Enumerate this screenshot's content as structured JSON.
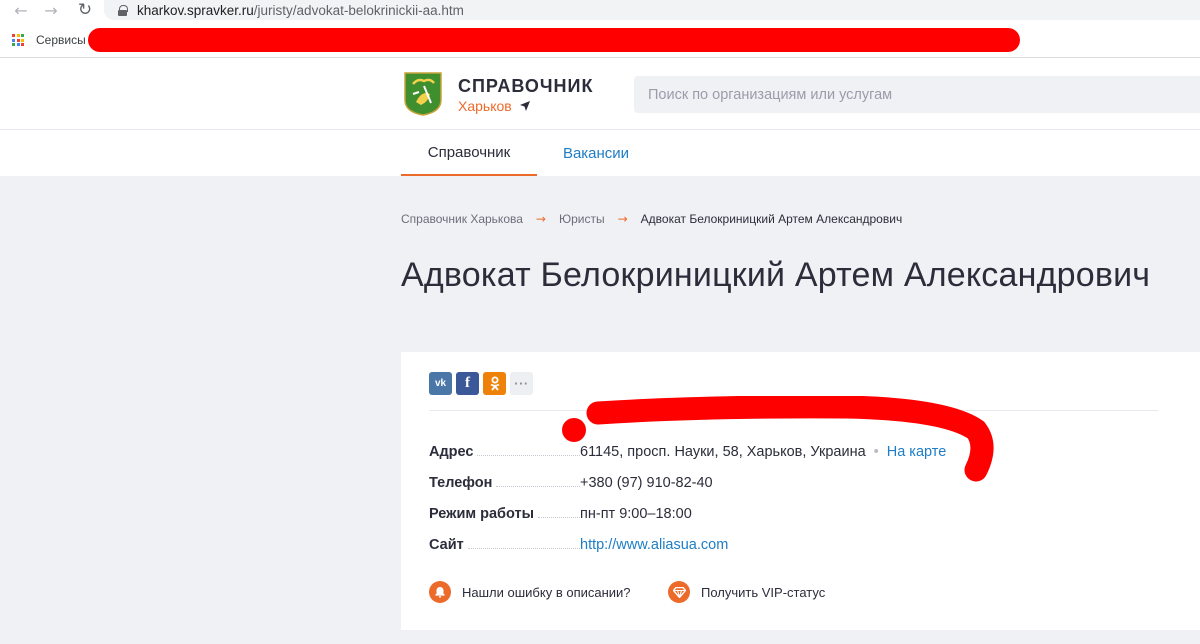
{
  "browser": {
    "url_host": "kharkov.spravker.ru",
    "url_path": "/juristy/advokat-belokrinickii-aa.htm",
    "apps_label": "Сервисы"
  },
  "header": {
    "logo_title": "СПРАВОЧНИК",
    "city": "Харьков",
    "search_placeholder": "Поиск по организациям или услугам"
  },
  "tabs": [
    {
      "label": "Справочник",
      "active": true
    },
    {
      "label": "Вакансии",
      "active": false
    }
  ],
  "breadcrumb": [
    "Справочник Харькова",
    "Юристы",
    "Адвокат Белокриницкий Артем Александрович"
  ],
  "page_title": "Адвокат Белокриницкий Артем Александрович",
  "share": {
    "vk": "vk",
    "fb": "f",
    "ok": "ok",
    "more": "···"
  },
  "info": {
    "address_label": "Адрес",
    "address_value": "61145, просп. Науки, 58, Харьков, Украина",
    "map_link": "На карте",
    "phone_label": "Телефон",
    "phone_value": "+380 (97) 910-82-40",
    "hours_label": "Режим работы",
    "hours_value": "пн-пт 9:00–18:00",
    "site_label": "Сайт",
    "site_value": "http://www.aliasua.com"
  },
  "actions": {
    "report_error": "Нашли ошибку в описании?",
    "vip_status": "Получить VIP-статус"
  },
  "colors": {
    "accent": "#ec6a2a",
    "link": "#1d7dc6",
    "redaction": "#ff0000"
  }
}
